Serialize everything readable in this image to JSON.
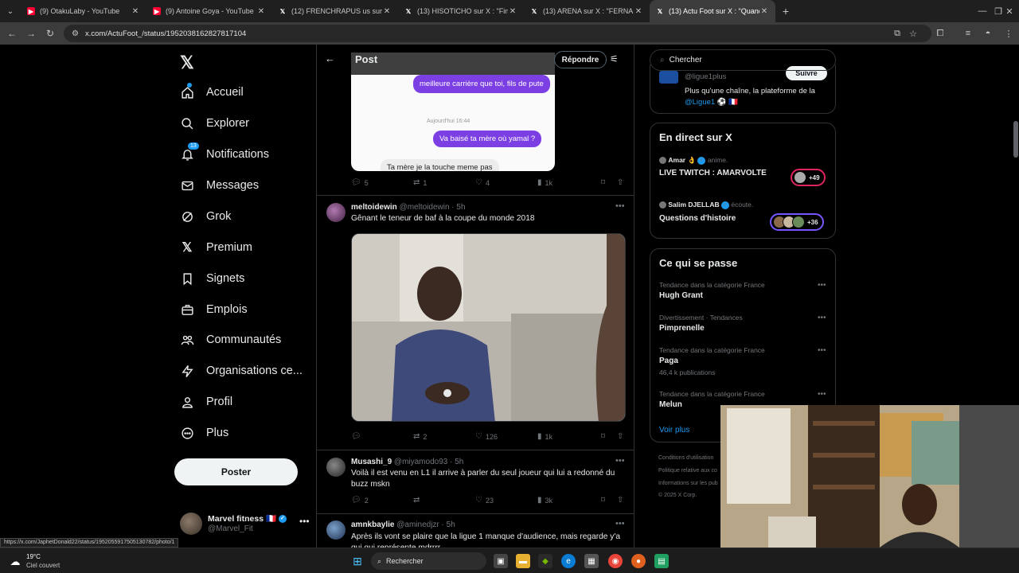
{
  "browser": {
    "tabs": [
      {
        "label": "(9) OtakuLaby - YouTube",
        "icon": "youtube-icon",
        "active": false
      },
      {
        "label": "(9) Antoine Goya - YouTube",
        "icon": "youtube-icon",
        "active": false
      },
      {
        "label": "(12) FRENCHRAPUS us sur X : \"",
        "icon": "x-icon",
        "active": false
      },
      {
        "label": "(13) HISOTICHO sur X : \"Fin du",
        "icon": "x-icon",
        "active": false
      },
      {
        "label": "(13) ARENA sur X : \"FERNAND",
        "icon": "x-icon",
        "active": false
      },
      {
        "label": "(13) Actu Foot sur X : \"Quand",
        "icon": "x-icon",
        "active": true
      }
    ],
    "url": "x.com/ActuFoot_/status/1952038162827817104",
    "status_url": "https://x.com/JaphetDonald22/status/1952055917505130782/photo/1"
  },
  "nav": {
    "items": [
      {
        "label": "Accueil",
        "icon": "home-icon"
      },
      {
        "label": "Explorer",
        "icon": "search-icon"
      },
      {
        "label": "Notifications",
        "icon": "bell-icon",
        "badge": "13"
      },
      {
        "label": "Messages",
        "icon": "envelope-icon"
      },
      {
        "label": "Grok",
        "icon": "grok-icon"
      },
      {
        "label": "Premium",
        "icon": "x-premium-icon"
      },
      {
        "label": "Signets",
        "icon": "bookmark-icon"
      },
      {
        "label": "Emplois",
        "icon": "briefcase-icon"
      },
      {
        "label": "Communautés",
        "icon": "people-icon"
      },
      {
        "label": "Organisations ce...",
        "icon": "lightning-icon"
      },
      {
        "label": "Profil",
        "icon": "person-icon"
      },
      {
        "label": "Plus",
        "icon": "more-circle-icon"
      }
    ],
    "post_button": "Poster",
    "account": {
      "name": "Marvel fitness 🇫🇷",
      "handle": "@Marvel_Fit"
    }
  },
  "header": {
    "title": "Post",
    "reply_button": "Répondre"
  },
  "chat": {
    "msg1": "meilleure carrière que toi, fils de pute",
    "time": "Aujourd'hui 16:44",
    "msg2": "Va baisé ta mère où yamal ?",
    "msg3": "Ta mère je la touche meme pas"
  },
  "tweets": [
    {
      "replies": "5",
      "reposts": "1",
      "likes": "4",
      "views": "1k"
    },
    {
      "name": "meltoidewin",
      "handle": "@meltoidewin · 5h",
      "text": "Gênant le teneur de baf à la coupe du monde 2018",
      "replies": "",
      "reposts": "2",
      "likes": "126",
      "views": "1k"
    },
    {
      "name": "Musashi_9",
      "handle": "@miyamodo93 · 5h",
      "text": "Voilà il est venu en L1 il arrive à parler du seul joueur qui lui a redonné du buzz mskn",
      "replies": "2",
      "reposts": "",
      "likes": "23",
      "views": "3k"
    },
    {
      "name": "amnkbaylie",
      "handle": "@aminedjzr · 5h",
      "text": "Après ils vont se plaire que la ligue 1 manque d'audience, mais regarde y'a qui qui représente mdrrrr"
    }
  ],
  "right": {
    "search_placeholder": "Chercher",
    "follow_card": {
      "handle": "@ligue1plus",
      "follow": "Suivre",
      "bio": "Plus qu'une chaîne, la plateforme de la",
      "bio_link": "@Ligue1 ⚽ 🇫🇷"
    },
    "live_title": "En direct sur X",
    "lives": [
      {
        "host": "Amar 👌",
        "role": "anime.",
        "title": "LIVE TWITCH : AMARVOLTE",
        "count": "+49"
      },
      {
        "host": "Salim DJELLAB",
        "role": "écoute.",
        "title": "Questions d'histoire",
        "count": "+36"
      }
    ],
    "trends_title": "Ce qui se passe",
    "trends": [
      {
        "category": "Tendance dans la catégorie France",
        "name": "Hugh Grant",
        "posts": ""
      },
      {
        "category": "Divertissement · Tendances",
        "name": "Pimprenelle",
        "posts": ""
      },
      {
        "category": "Tendance dans la catégorie France",
        "name": "Paga",
        "posts": "46,4 k publications"
      },
      {
        "category": "Tendance dans la catégorie France",
        "name": "Melun",
        "posts": ""
      }
    ],
    "see_more": "Voir plus",
    "footer": [
      "Conditions d'utilisation",
      "Politique relative aux co",
      "Informations sur les pub",
      "© 2025 X Corp."
    ]
  },
  "taskbar": {
    "temp": "19°C",
    "weather": "Ciel couvert",
    "search": "Rechercher"
  },
  "colors": {
    "accent": "#1d9bf0",
    "live_border": "#7856ff",
    "chat_purple": "#7b3fe4"
  }
}
